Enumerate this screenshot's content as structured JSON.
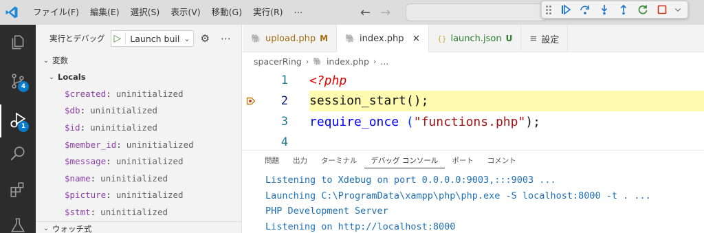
{
  "menu": [
    "ファイル(F)",
    "編集(E)",
    "選択(S)",
    "表示(V)",
    "移動(G)",
    "実行(R)",
    "⋯"
  ],
  "nav": {
    "back": "←",
    "forward": "→"
  },
  "debug_toolbar": {
    "buttons": [
      "continue",
      "step-over",
      "step-into",
      "step-out",
      "restart",
      "stop"
    ],
    "colors": {
      "blue": "#1a73c8",
      "green": "#388a34",
      "red": "#c72e0f"
    }
  },
  "activity": {
    "source_control_badge": "4",
    "run_debug_badge": "1"
  },
  "sidebar": {
    "run_label": "実行とデバッグ",
    "launch_config": "Launch buil",
    "variables_title": "変数",
    "locals_title": "Locals",
    "variables": [
      {
        "name": "$created",
        "value": "uninitialized"
      },
      {
        "name": "$db",
        "value": "uninitialized"
      },
      {
        "name": "$id",
        "value": "uninitialized"
      },
      {
        "name": "$member_id",
        "value": "uninitialized"
      },
      {
        "name": "$message",
        "value": "uninitialized"
      },
      {
        "name": "$name",
        "value": "uninitialized"
      },
      {
        "name": "$picture",
        "value": "uninitialized"
      },
      {
        "name": "$stmt",
        "value": "uninitialized"
      }
    ],
    "watch_title": "ウォッチ式"
  },
  "tabs": [
    {
      "label": "upload.php",
      "badge": "M"
    },
    {
      "label": "index.php",
      "close": "×"
    },
    {
      "label": "launch.json",
      "badge": "U",
      "icon": "{}"
    },
    {
      "label": "設定"
    }
  ],
  "breadcrumb": {
    "folder": "spacerRing",
    "file": "index.php",
    "more": "..."
  },
  "code": {
    "lines": [
      {
        "num": "1",
        "text": "<?php"
      },
      {
        "num": "2",
        "text_fn": "session_start",
        "text_rest": "();"
      },
      {
        "num": "3",
        "text_kw": "require_once",
        "text_str": "\"functions.php\"",
        "text_end": ");"
      },
      {
        "num": "4"
      }
    ],
    "current_line": "2"
  },
  "panel": {
    "tabs": [
      "問題",
      "出力",
      "ターミナル",
      "デバッグ コンソール",
      "ポート",
      "コメント"
    ],
    "active_tab": "デバッグ コンソール",
    "console": [
      "Listening to Xdebug on port 0.0.0.0:9003,:::9003 ...",
      "Launching C:\\ProgramData\\xampp\\php\\php.exe -S localhost:8000 -t . ...",
      "PHP Development Server",
      "Listening on http://localhost:8000"
    ]
  },
  "colors": {
    "accent": "#0a7aca",
    "activitybar": "#2c2c2c",
    "current_line": "#fffbb0",
    "var_name": "#8b3fa6",
    "console_text": "#1d6fb8",
    "php_tag": "#e00000",
    "function": "#795e26",
    "keyword": "#0000ff",
    "string": "#a31515"
  }
}
